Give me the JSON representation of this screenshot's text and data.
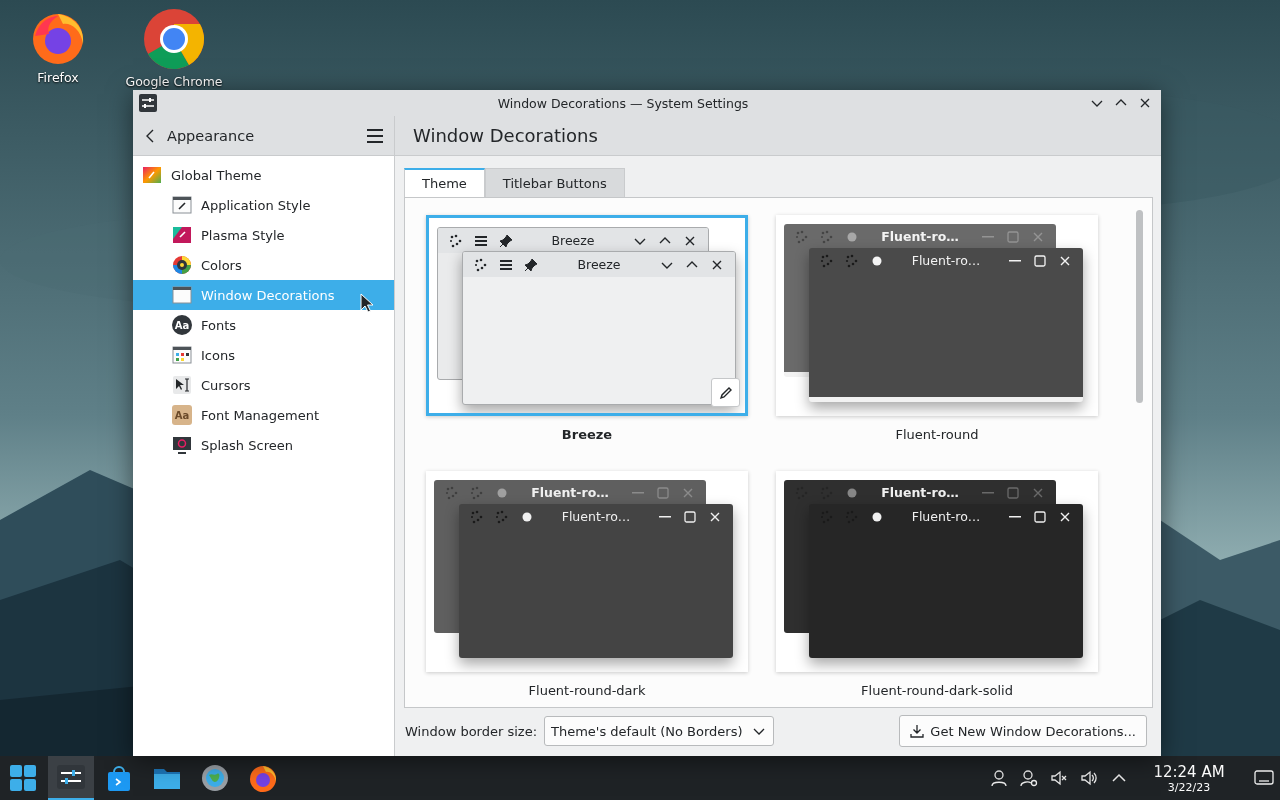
{
  "desktop": {
    "icons": [
      {
        "label": "Firefox",
        "kind": "firefox"
      },
      {
        "label": "Google Chrome",
        "kind": "chrome"
      }
    ]
  },
  "window": {
    "title": "Window Decorations — System Settings"
  },
  "sidebar": {
    "back_label": "Appearance",
    "items": [
      {
        "label": "Global Theme",
        "kind": "global-theme",
        "selected": false,
        "children": [
          {
            "label": "Application Style",
            "kind": "application-style",
            "selected": false
          },
          {
            "label": "Plasma Style",
            "kind": "plasma-style",
            "selected": false
          },
          {
            "label": "Colors",
            "kind": "colors",
            "selected": false
          },
          {
            "label": "Window Decorations",
            "kind": "window-decorations",
            "selected": true
          },
          {
            "label": "Fonts",
            "kind": "fonts",
            "icon_text": "Aa",
            "selected": false
          },
          {
            "label": "Icons",
            "kind": "icons",
            "selected": false
          },
          {
            "label": "Cursors",
            "kind": "cursors",
            "selected": false
          },
          {
            "label": "Font Management",
            "kind": "font-management",
            "icon_text": "Aa",
            "selected": false
          },
          {
            "label": "Splash Screen",
            "kind": "splash-screen",
            "selected": false
          }
        ]
      }
    ]
  },
  "page": {
    "title": "Window Decorations",
    "tabs": [
      {
        "label": "Theme",
        "selected": true
      },
      {
        "label": "Titlebar Buttons",
        "selected": false
      }
    ],
    "decorations": [
      {
        "name": "Breeze",
        "kind": "breeze",
        "selected": true,
        "back_title": "Breeze",
        "front_title": "Breeze"
      },
      {
        "name": "Fluent-round",
        "kind": "fluent-round",
        "selected": false,
        "back_title": "Fluent-ro…",
        "front_title": "Fluent-ro…"
      },
      {
        "name": "Fluent-round-dark",
        "kind": "fluent-round-dark",
        "selected": false,
        "back_title": "Fluent-ro…",
        "front_title": "Fluent-ro…"
      },
      {
        "name": "Fluent-round-dark-solid",
        "kind": "fluent-round-dark-solid",
        "selected": false,
        "back_title": "Fluent-ro…",
        "front_title": "Fluent-ro…"
      }
    ],
    "border_size": {
      "label": "Window border size:",
      "value": "Theme's default (No Borders)"
    },
    "get_new_button": "Get New Window Decorations..."
  },
  "taskbar": {
    "apps": [
      {
        "kind": "start",
        "active": false
      },
      {
        "kind": "system-settings",
        "active": true
      },
      {
        "kind": "discover",
        "active": false
      },
      {
        "kind": "files",
        "active": false
      },
      {
        "kind": "globe-settings",
        "active": false
      },
      {
        "kind": "firefox",
        "active": false
      }
    ],
    "tray": [
      {
        "kind": "person"
      },
      {
        "kind": "person-settings"
      },
      {
        "kind": "speaker-muted"
      },
      {
        "kind": "speaker"
      },
      {
        "kind": "caret-up"
      }
    ],
    "time": "12:24 AM",
    "date": "3/22/23"
  }
}
